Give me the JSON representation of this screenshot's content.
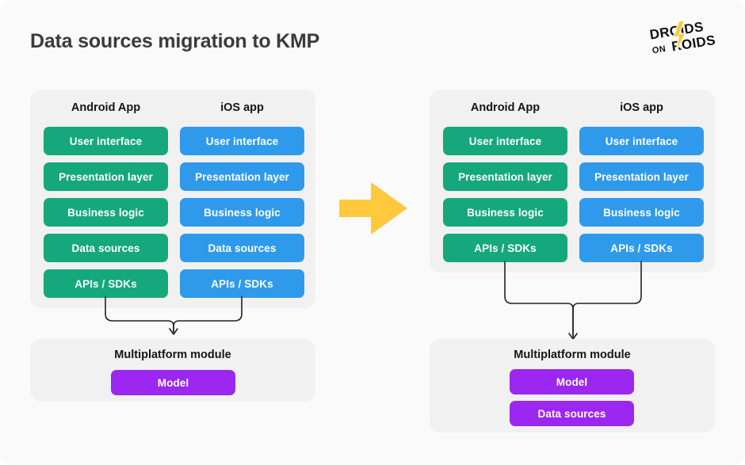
{
  "page": {
    "title": "Data sources migration to KMP",
    "background": "#fafafa"
  },
  "logo": {
    "name": "droids-on-roids-logo",
    "line1": "DROIDS",
    "line2_small": "ON",
    "line2": "ROIDS",
    "bolt_color": "#FFC933",
    "text_color": "#111111"
  },
  "colors": {
    "android": "#15a87c",
    "ios": "#2f9aec",
    "shared": "#9b27f0",
    "panel": "#f1f1f1",
    "arrow": "#FFC83D",
    "connector": "#222222",
    "title": "#3b3b3b"
  },
  "before": {
    "android": {
      "title": "Android App",
      "layers": [
        "User interface",
        "Presentation layer",
        "Business logic",
        "Data sources",
        "APIs / SDKs"
      ]
    },
    "ios": {
      "title": "iOS app",
      "layers": [
        "User interface",
        "Presentation layer",
        "Business logic",
        "Data sources",
        "APIs / SDKs"
      ]
    },
    "module": {
      "title": "Multiplatform module",
      "layers": [
        "Model"
      ]
    }
  },
  "after": {
    "android": {
      "title": "Android App",
      "layers": [
        "User interface",
        "Presentation layer",
        "Business logic",
        "APIs / SDKs"
      ]
    },
    "ios": {
      "title": "iOS app",
      "layers": [
        "User interface",
        "Presentation layer",
        "Business logic",
        "APIs / SDKs"
      ]
    },
    "module": {
      "title": "Multiplatform module",
      "layers": [
        "Model",
        "Data sources"
      ]
    }
  },
  "transition": {
    "icon": "right-arrow-icon"
  }
}
